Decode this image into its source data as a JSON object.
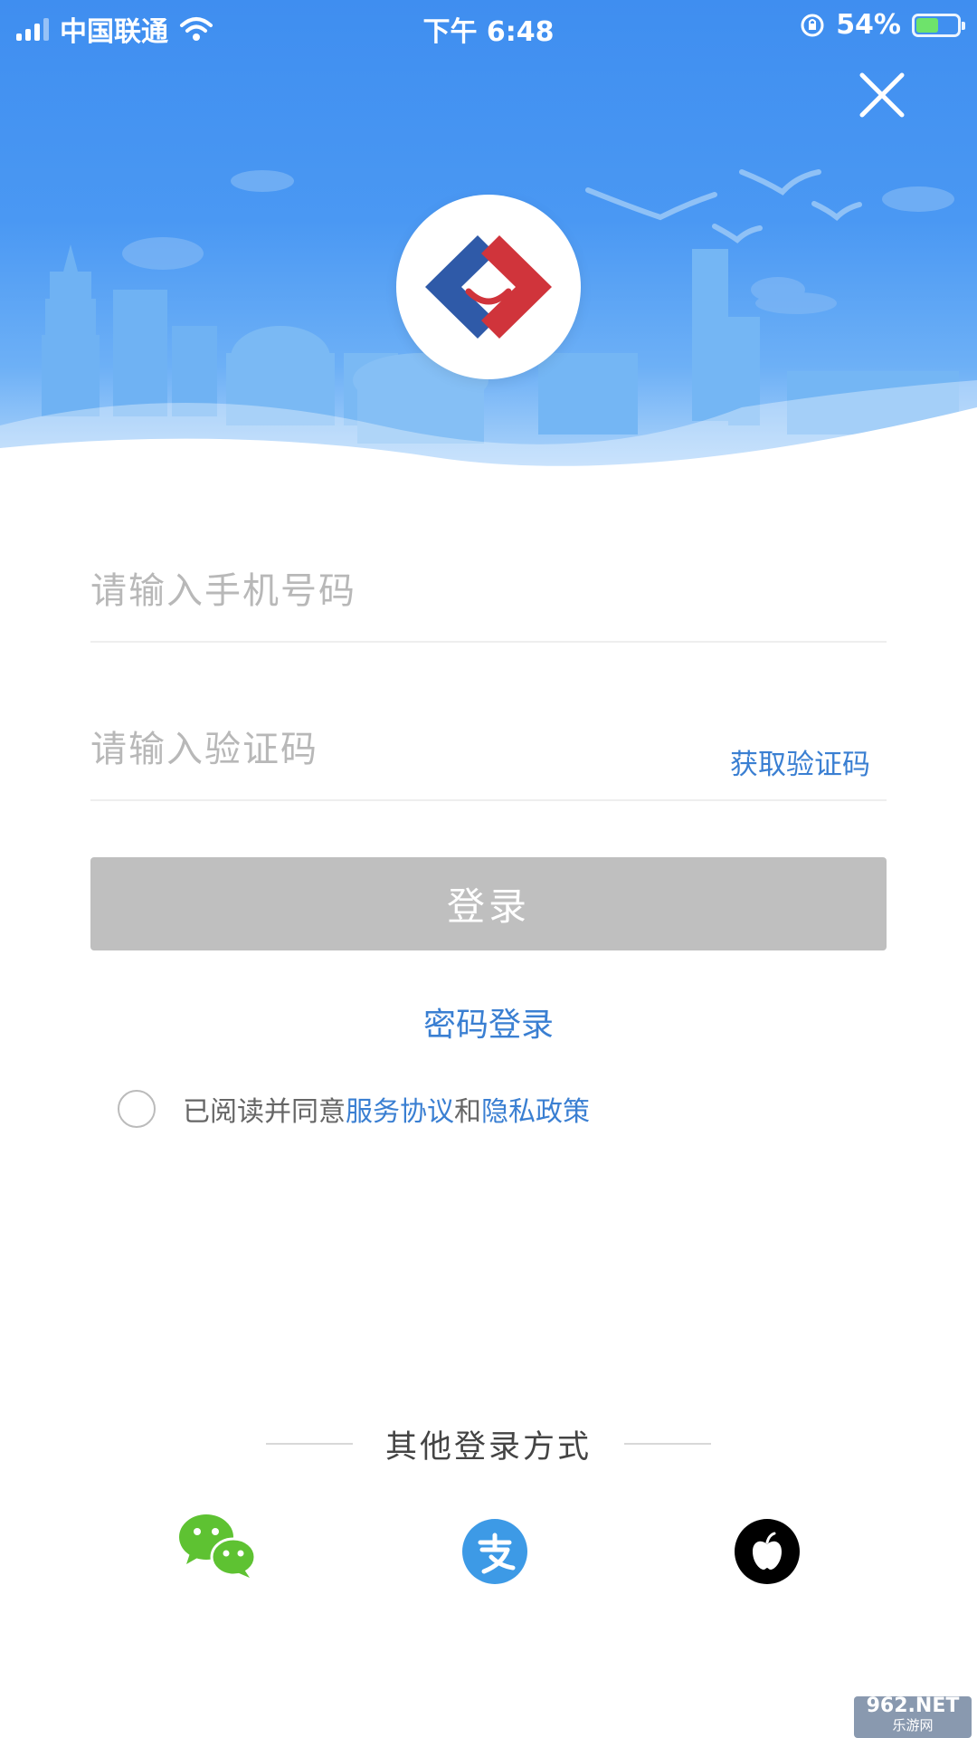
{
  "status_bar": {
    "carrier": "中国联通",
    "time": "下午 6:48",
    "battery": "54%",
    "battery_level": 0.54
  },
  "form": {
    "phone_placeholder": "请输入手机号码",
    "code_placeholder": "请输入验证码",
    "get_code_label": "获取验证码",
    "login_label": "登录",
    "password_login_label": "密码登录"
  },
  "agreement": {
    "prefix": "已阅读并同意",
    "service_label": "服务协议",
    "and": "和",
    "privacy_label": "隐私政策",
    "checked": false
  },
  "other_login": {
    "title": "其他登录方式",
    "methods": [
      {
        "name": "wechat",
        "icon": "wechat-icon",
        "color": "#5ec232"
      },
      {
        "name": "alipay",
        "icon": "alipay-icon",
        "color": "#3d9ae6"
      },
      {
        "name": "apple",
        "icon": "apple-icon",
        "color": "#000000"
      }
    ]
  },
  "watermark": {
    "brand": "962.NET",
    "sub": "乐游网"
  },
  "colors": {
    "header_blue": "#4a98f3",
    "link_blue": "#3a7fd2",
    "button_disabled": "#bfbfbf"
  }
}
